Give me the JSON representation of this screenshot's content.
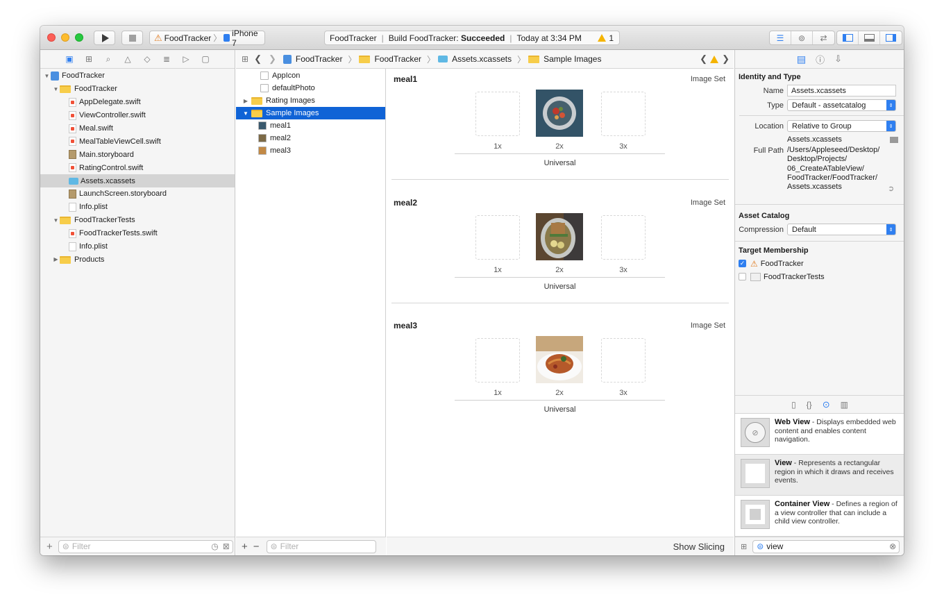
{
  "toolbar": {
    "scheme": "FoodTracker",
    "device": "iPhone 7",
    "activity": {
      "project": "FoodTracker",
      "build_label": "Build FoodTracker:",
      "build_status": "Succeeded",
      "time": "Today at 3:34 PM",
      "warning_count": "1"
    }
  },
  "navigator": {
    "tree": [
      {
        "label": "FoodTracker",
        "indent": 0,
        "disclosure": "down",
        "icon": "project-icon"
      },
      {
        "label": "FoodTracker",
        "indent": 1,
        "disclosure": "down",
        "icon": "folder-icon"
      },
      {
        "label": "AppDelegate.swift",
        "indent": 2,
        "icon": "swift-file-icon"
      },
      {
        "label": "ViewController.swift",
        "indent": 2,
        "icon": "swift-file-icon"
      },
      {
        "label": "Meal.swift",
        "indent": 2,
        "icon": "swift-file-icon"
      },
      {
        "label": "MealTableViewCell.swift",
        "indent": 2,
        "icon": "swift-file-icon"
      },
      {
        "label": "Main.storyboard",
        "indent": 2,
        "icon": "storyboard-icon"
      },
      {
        "label": "RatingControl.swift",
        "indent": 2,
        "icon": "swift-file-icon"
      },
      {
        "label": "Assets.xcassets",
        "indent": 2,
        "icon": "asset-catalog-icon",
        "selected": true
      },
      {
        "label": "LaunchScreen.storyboard",
        "indent": 2,
        "icon": "storyboard-icon"
      },
      {
        "label": "Info.plist",
        "indent": 2,
        "icon": "plist-icon"
      },
      {
        "label": "FoodTrackerTests",
        "indent": 1,
        "disclosure": "down",
        "icon": "folder-icon"
      },
      {
        "label": "FoodTrackerTests.swift",
        "indent": 2,
        "icon": "swift-file-icon"
      },
      {
        "label": "Info.plist",
        "indent": 2,
        "icon": "plist-icon"
      },
      {
        "label": "Products",
        "indent": 1,
        "disclosure": "right",
        "icon": "folder-icon"
      }
    ],
    "filter_placeholder": "Filter"
  },
  "jumpbar": {
    "crumbs": [
      "FoodTracker",
      "FoodTracker",
      "Assets.xcassets",
      "Sample Images"
    ]
  },
  "asset_list": {
    "items": [
      {
        "label": "AppIcon",
        "indent": 1,
        "icon": "app-icon-set-icon"
      },
      {
        "label": "defaultPhoto",
        "indent": 1,
        "icon": "image-set-icon"
      },
      {
        "label": "Rating Images",
        "indent": 0,
        "disclosure": "right",
        "icon": "folder-icon"
      },
      {
        "label": "Sample Images",
        "indent": 0,
        "disclosure": "down",
        "icon": "folder-icon",
        "selected": true
      },
      {
        "label": "meal1",
        "indent": 2,
        "icon": "image-set-icon"
      },
      {
        "label": "meal2",
        "indent": 2,
        "icon": "image-set-icon"
      },
      {
        "label": "meal3",
        "indent": 2,
        "icon": "image-set-icon"
      }
    ],
    "filter_placeholder": "Filter"
  },
  "editor": {
    "sets": [
      {
        "name": "meal1",
        "kind": "Image Set",
        "scales": [
          "1x",
          "2x",
          "3x"
        ],
        "idiom": "Universal"
      },
      {
        "name": "meal2",
        "kind": "Image Set",
        "scales": [
          "1x",
          "2x",
          "3x"
        ],
        "idiom": "Universal"
      },
      {
        "name": "meal3",
        "kind": "Image Set",
        "scales": [
          "1x",
          "2x",
          "3x"
        ],
        "idiom": "Universal"
      }
    ],
    "show_slicing": "Show Slicing"
  },
  "inspector": {
    "identity_title": "Identity and Type",
    "name_label": "Name",
    "name_value": "Assets.xcassets",
    "type_label": "Type",
    "type_value": "Default - assetcatalog",
    "location_label": "Location",
    "location_value": "Relative to Group",
    "location_file": "Assets.xcassets",
    "fullpath_label": "Full Path",
    "fullpath_value": "/Users/Appleseed/Desktop/\nDesktop/Projects/\n06_CreateATableView/\nFoodTracker/FoodTracker/\nAssets.xcassets",
    "catalog_title": "Asset Catalog",
    "compression_label": "Compression",
    "compression_value": "Default",
    "membership_title": "Target Membership",
    "targets": [
      {
        "label": "FoodTracker",
        "checked": true
      },
      {
        "label": "FoodTrackerTests",
        "checked": false
      }
    ]
  },
  "library": {
    "items": [
      {
        "title": "Web View",
        "desc": " - Displays embedded web content and enables content navigation."
      },
      {
        "title": "View",
        "desc": " - Represents a rectangular region in which it draws and receives events."
      },
      {
        "title": "Container View",
        "desc": " - Defines a region of a view controller that can include a child view controller."
      }
    ],
    "search_value": "view"
  },
  "colors": {
    "selection": "#1063d6",
    "accent": "#2f7ff0",
    "folder": "#f7cd4a"
  }
}
